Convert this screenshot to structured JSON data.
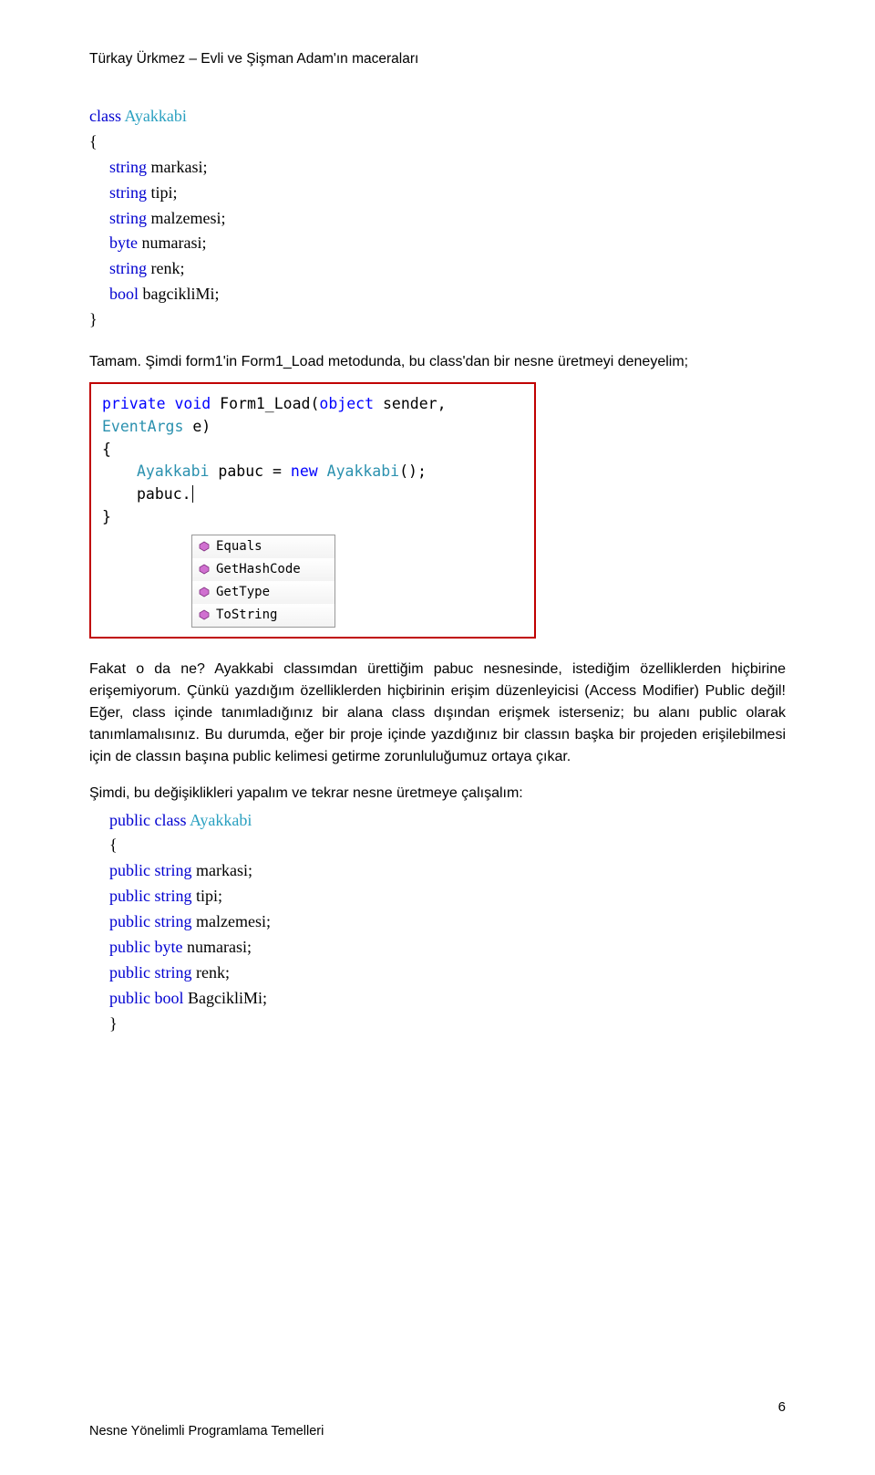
{
  "header": "Türkay Ürkmez – Evli ve Şişman Adam'ın maceraları",
  "code1": {
    "kw_class": "class",
    "typename": "Ayakkabi",
    "lines": [
      {
        "kw": "string",
        "name": "markasi;"
      },
      {
        "kw": "string",
        "name": "tipi;"
      },
      {
        "kw": "string",
        "name": "malzemesi;"
      },
      {
        "kw": "byte",
        "name": "numarasi;"
      },
      {
        "kw": "string",
        "name": "renk;"
      },
      {
        "kw": "bool",
        "name": "bagcikliMi;"
      }
    ]
  },
  "para1": "Tamam. Şimdi form1'in Form1_Load metodunda, bu class'dan bir nesne üretmeyi deneyelim;",
  "screenshot": {
    "sig_pre": "private void ",
    "sig_name": "Form1_Load(",
    "sig_arg1_type": "object",
    "sig_arg1_name": " sender, ",
    "sig_arg2_type": "EventArgs",
    "sig_arg2_name": " e)",
    "line2_type1": "Ayakkabi",
    "line2_mid": " pabuc = ",
    "line2_kw": "new",
    "line2_type2": " Ayakkabi",
    "line2_end": "();",
    "line3": "pabuc.",
    "intellisense": [
      "Equals",
      "GetHashCode",
      "GetType",
      "ToString"
    ]
  },
  "para2": "Fakat o da ne? Ayakkabi classımdan ürettiğim pabuc nesnesinde, istediğim özelliklerden hiçbirine erişemiyorum. Çünkü yazdığım özelliklerden hiçbirinin erişim düzenleyicisi (Access Modifier) Public değil! Eğer, class içinde tanımladığınız bir alana class dışından erişmek isterseniz; bu alanı public olarak tanımlamalısınız. Bu durumda, eğer bir proje içinde yazdığınız bir classın başka bir projeden erişilebilmesi için de classın başına public kelimesi getirme zorunluluğumuz ortaya çıkar.",
  "para3": "Şimdi, bu değişiklikleri yapalım ve tekrar nesne üretmeye çalışalım:",
  "code2": {
    "kw_public": "public",
    "kw_class": "class",
    "typename": "Ayakkabi",
    "lines": [
      {
        "p": "public",
        "kw": "string",
        "name": "markasi;"
      },
      {
        "p": "public",
        "kw": "string",
        "name": "tipi;"
      },
      {
        "p": "public",
        "kw": "string",
        "name": "malzemesi;"
      },
      {
        "p": "public",
        "kw": "byte",
        "name": "numarasi;"
      },
      {
        "p": "public",
        "kw": "string",
        "name": "renk;"
      },
      {
        "p": "public",
        "kw": "bool",
        "name": "BagcikliMi;"
      }
    ]
  },
  "footer": "Nesne Yönelimli Programlama Temelleri",
  "pagenum": "6"
}
